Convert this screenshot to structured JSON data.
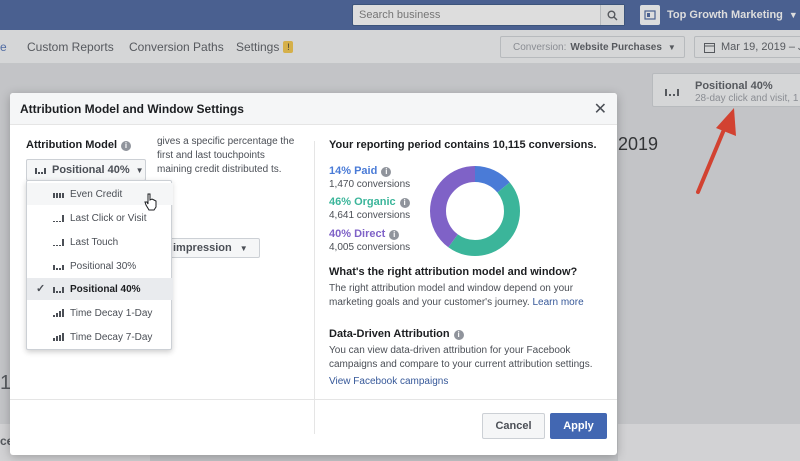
{
  "topbar": {
    "search_placeholder": "Search business",
    "account_name": "Top Growth Marketing"
  },
  "subnav": {
    "tabs": [
      {
        "label": "e"
      },
      {
        "label": "Custom Reports"
      },
      {
        "label": "Conversion Paths"
      },
      {
        "label": "Settings"
      }
    ],
    "settings_badge": "!",
    "conversion_label": "Conversion:",
    "conversion_value": "Website Purchases",
    "date_range": "Mar 19, 2019 – Ju"
  },
  "background": {
    "positional_title": "Positional 40%",
    "positional_sub": "28-day click and visit, 1",
    "year_text": "2019",
    "edge_1": "1",
    "edge_2": "ce"
  },
  "modal": {
    "title": "Attribution Model and Window Settings",
    "attribution_label": "Attribution Model",
    "model_selected": "Positional 40%",
    "description": "gives a specific percentage the first and last touchpoints maining credit distributed ts.",
    "window_value": "impression",
    "dropdown_items": [
      {
        "label": "Even Credit"
      },
      {
        "label": "Last Click or Visit"
      },
      {
        "label": "Last Touch"
      },
      {
        "label": "Positional 30%"
      },
      {
        "label": "Positional 40%"
      },
      {
        "label": "Time Decay 1-Day"
      },
      {
        "label": "Time Decay 7-Day"
      }
    ],
    "report_head": "Your reporting period contains 10,115 conversions.",
    "stats": [
      {
        "pct": "14% Paid",
        "count": "1,470 conversions",
        "color": "#4a7bd7"
      },
      {
        "pct": "46% Organic",
        "count": "4,641 conversions",
        "color": "#3bb59a"
      },
      {
        "pct": "40% Direct",
        "count": "4,005 conversions",
        "color": "#7f62c7"
      }
    ],
    "donut_shares": [
      14,
      46,
      40
    ],
    "question_head": "What's the right attribution model and window?",
    "question_body": "The right attribution model and window depend on your marketing goals and your customer's journey.",
    "learn_more": "Learn more",
    "dda_head": "Data-Driven Attribution",
    "dda_body": "You can view data-driven attribution for your Facebook campaigns and compare to your current attribution settings.",
    "dda_link": "View Facebook campaigns",
    "cancel_label": "Cancel",
    "apply_label": "Apply"
  }
}
